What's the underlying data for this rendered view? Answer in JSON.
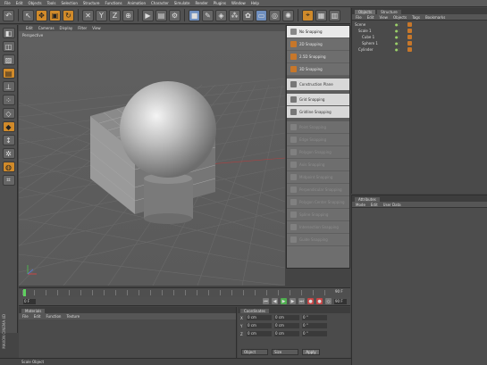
{
  "menubar": [
    "File",
    "Edit",
    "Objects",
    "Tools",
    "Selection",
    "Structure",
    "Functions",
    "Animation",
    "Character",
    "Simulate",
    "Render",
    "Plugins",
    "Window",
    "Help"
  ],
  "viewport": {
    "menu": [
      "Edit",
      "Cameras",
      "Display",
      "Filter",
      "View"
    ],
    "label": "Perspective"
  },
  "snapping_menu": {
    "items": [
      {
        "label": "No Snapping",
        "state": "checked"
      },
      {
        "label": "2D Snapping",
        "state": "normal"
      },
      {
        "label": "2.5D Snapping",
        "state": "normal"
      },
      {
        "label": "3D Snapping",
        "state": "normal"
      },
      {
        "label": "Construction Plane",
        "state": "light"
      },
      {
        "label": "Grid Snapping",
        "state": "light"
      },
      {
        "label": "Gridline Snapping",
        "state": "light"
      },
      {
        "label": "Point Snapping",
        "state": "disabled"
      },
      {
        "label": "Edge Snapping",
        "state": "disabled"
      },
      {
        "label": "Polygon Snapping",
        "state": "disabled"
      },
      {
        "label": "Axis Snapping",
        "state": "disabled"
      },
      {
        "label": "Midpoint Snapping",
        "state": "disabled"
      },
      {
        "label": "Perpendicular Snapping",
        "state": "disabled"
      },
      {
        "label": "Polygon Center Snapping",
        "state": "disabled"
      },
      {
        "label": "Spline Snapping",
        "state": "disabled"
      },
      {
        "label": "Intersection Snapping",
        "state": "disabled"
      },
      {
        "label": "Guide Snapping",
        "state": "disabled"
      }
    ]
  },
  "objects_panel": {
    "tabs": [
      "Objects",
      "Structure"
    ],
    "menu": [
      "File",
      "Edit",
      "View",
      "Objects",
      "Tags",
      "Bookmarks"
    ],
    "rows": [
      {
        "name": "Scene",
        "indent": 0
      },
      {
        "name": "Scale 1",
        "indent": 1
      },
      {
        "name": "Cube 1",
        "indent": 2
      },
      {
        "name": "Sphere 1",
        "indent": 2
      },
      {
        "name": "Cylinder",
        "indent": 1
      }
    ]
  },
  "attributes_panel": {
    "tabs": [
      "Attributes"
    ],
    "menu": [
      "Mode",
      "Edit",
      "User Data"
    ]
  },
  "timeline": {
    "end_frame": "90 F",
    "current_frame": "0 F",
    "max_frame": "90 F"
  },
  "material_panel": {
    "tabs": [
      "Materials"
    ],
    "menu": [
      "File",
      "Edit",
      "Function",
      "Texture"
    ]
  },
  "coordinates_panel": {
    "tabs": [
      "Coordinates"
    ],
    "rows": [
      {
        "axis": "X",
        "pos": "0 cm",
        "size": "0 cm",
        "rot": "0 °"
      },
      {
        "axis": "Y",
        "pos": "0 cm",
        "size": "0 cm",
        "rot": "0 °"
      },
      {
        "axis": "Z",
        "pos": "0 cm",
        "size": "0 cm",
        "rot": "0 °"
      }
    ],
    "mode_select": "Object",
    "size_select": "Size",
    "apply_label": "Apply"
  },
  "status_bar": "Scale Object",
  "brand_text": "MAXON CINEMA 4D"
}
